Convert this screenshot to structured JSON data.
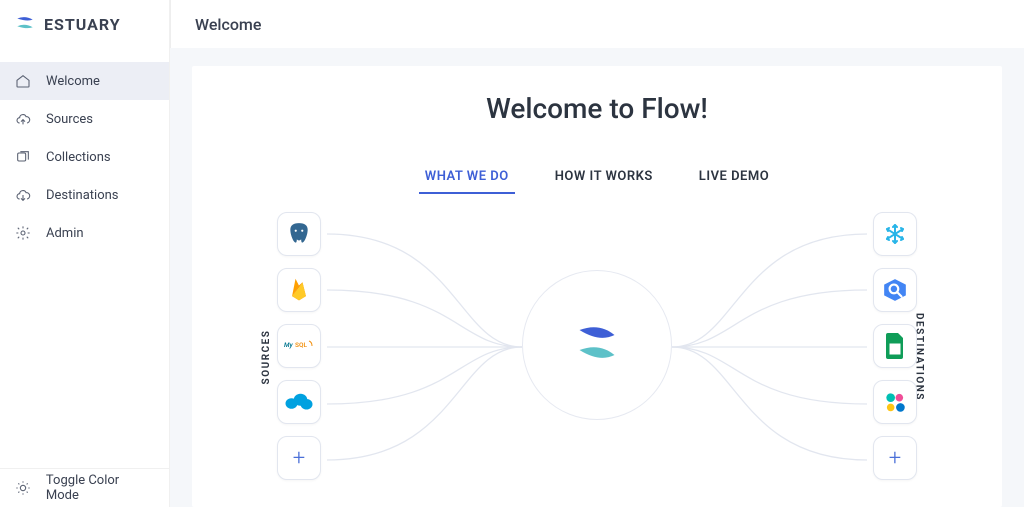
{
  "brand": {
    "name": "ESTUARY"
  },
  "header": {
    "title": "Welcome"
  },
  "sidebar": {
    "items": [
      {
        "label": "Welcome",
        "icon": "home",
        "active": true
      },
      {
        "label": "Sources",
        "icon": "cloud-up"
      },
      {
        "label": "Collections",
        "icon": "collections"
      },
      {
        "label": "Destinations",
        "icon": "cloud-down"
      },
      {
        "label": "Admin",
        "icon": "gear"
      }
    ],
    "footer": {
      "label": "Toggle Color Mode",
      "icon": "brightness"
    }
  },
  "welcome": {
    "title": "Welcome to Flow!",
    "tabs": [
      {
        "label": "WHAT WE DO",
        "active": true
      },
      {
        "label": "HOW IT WORKS"
      },
      {
        "label": "LIVE DEMO"
      }
    ],
    "sources_label": "SOURCES",
    "destinations_label": "DESTINATIONS",
    "sources": [
      {
        "name": "postgresql"
      },
      {
        "name": "firebase"
      },
      {
        "name": "mysql"
      },
      {
        "name": "salesforce"
      },
      {
        "name": "add"
      }
    ],
    "destinations": [
      {
        "name": "snowflake"
      },
      {
        "name": "bigquery"
      },
      {
        "name": "google-sheets"
      },
      {
        "name": "elasticsearch"
      },
      {
        "name": "add"
      }
    ]
  },
  "colors": {
    "primary": "#3e5fd6",
    "teal": "#5dc1c8"
  }
}
